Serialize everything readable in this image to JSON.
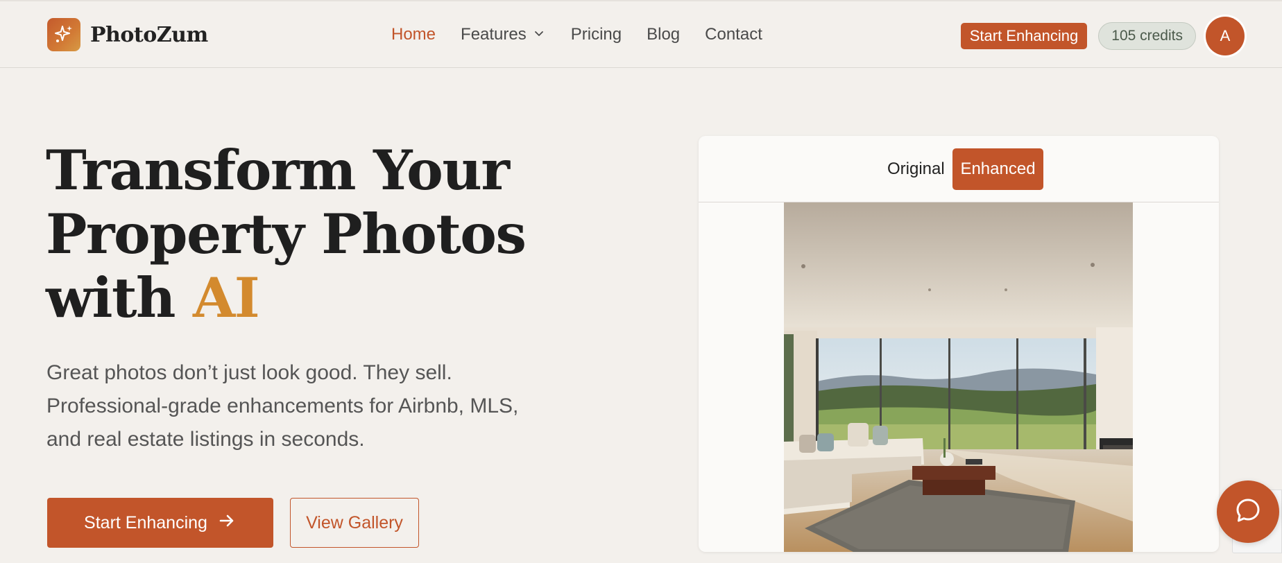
{
  "brand": {
    "name": "PhotoZum",
    "logo_icon": "sparkle-icon"
  },
  "nav": {
    "items": [
      {
        "label": "Home",
        "active": true
      },
      {
        "label": "Features",
        "has_dropdown": true
      },
      {
        "label": "Pricing"
      },
      {
        "label": "Blog"
      },
      {
        "label": "Contact"
      }
    ]
  },
  "header_actions": {
    "cta_label": "Start Enhancing",
    "credits_label": "105 credits",
    "avatar_initial": "A"
  },
  "hero": {
    "title_line1": "Transform Your",
    "title_line2": "Property Photos",
    "title_line3_prefix": "with ",
    "title_accent": "AI",
    "subtitle_line1": "Great photos don’t just look good. They sell.",
    "subtitle_line2": "Professional-grade enhancements for Airbnb, MLS,",
    "subtitle_line3": "and real estate listings in seconds.",
    "primary_button": "Start Enhancing",
    "secondary_button": "View Gallery"
  },
  "compare": {
    "toggle_original": "Original",
    "toggle_enhanced": "Enhanced",
    "selected": "Enhanced"
  },
  "colors": {
    "accent": "#c2552a",
    "ai_accent": "#d38a2e",
    "background": "#f3f0ec",
    "credits_bg": "#dfe3dc"
  },
  "icons": {
    "features_dropdown": "chevron-down-icon",
    "primary_button": "arrow-right-icon",
    "chat": "chat-bubble-icon"
  }
}
